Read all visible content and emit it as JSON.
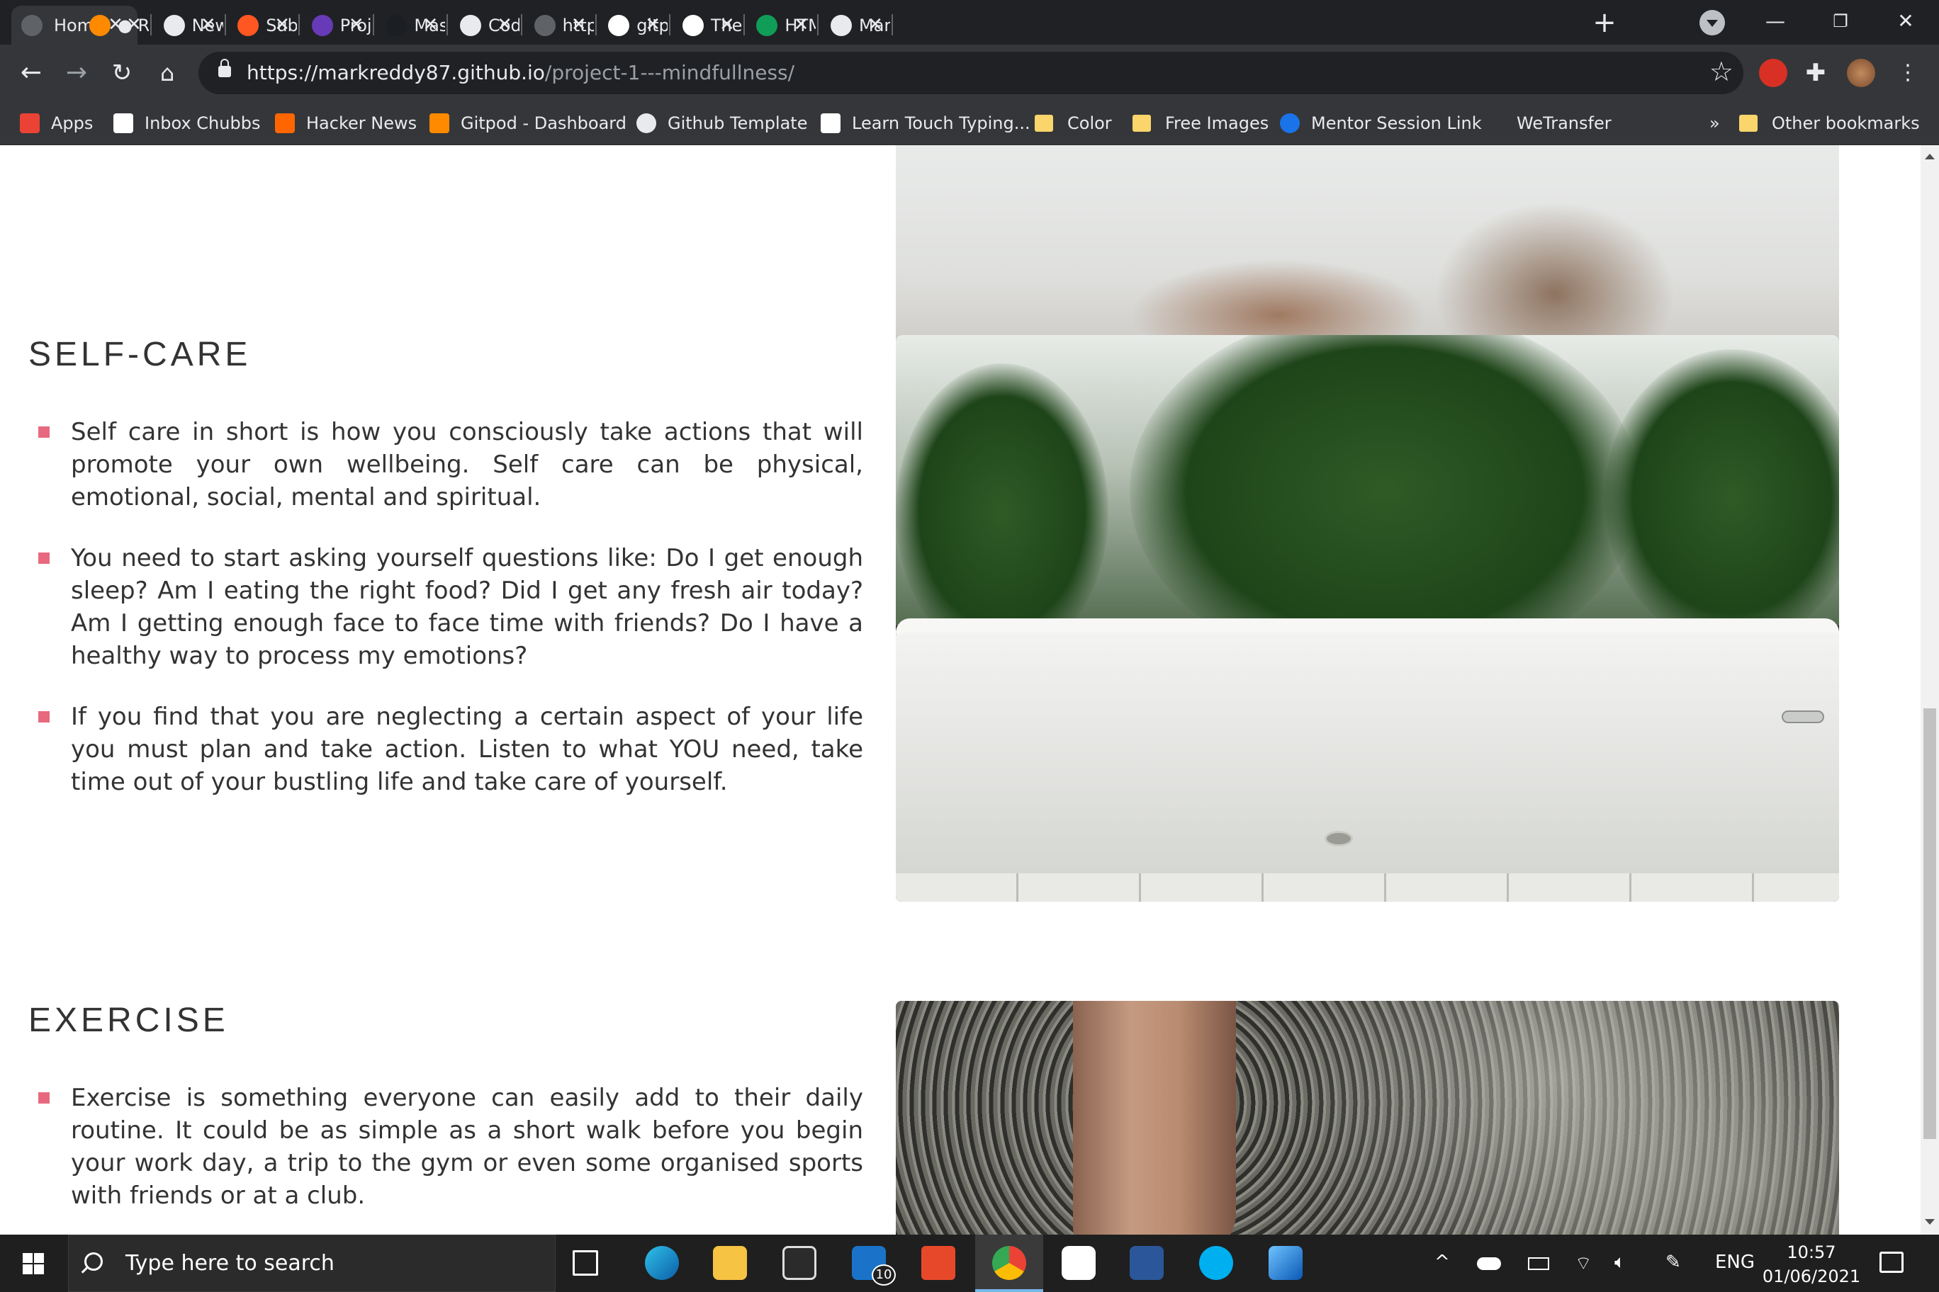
{
  "browser": {
    "tabs": [
      {
        "title": "Hom",
        "active": true,
        "icon": "globe-icon",
        "color": "#5f6368"
      },
      {
        "title": "● RE/",
        "icon": "gitpod-icon",
        "color": "#ff8a00"
      },
      {
        "title": "New",
        "icon": "smiley-icon",
        "color": "#e8eaed"
      },
      {
        "title": "Subn",
        "icon": "codeinstitute-icon",
        "color": "#ff5722"
      },
      {
        "title": "Proje",
        "icon": "list-icon",
        "color": "#673ab7"
      },
      {
        "title": "Mast",
        "icon": "github-icon",
        "color": "#1b1f23"
      },
      {
        "title": "Code",
        "icon": "github-icon",
        "color": "#e8eaed"
      },
      {
        "title": "https",
        "icon": "globe-icon",
        "color": "#5f6368"
      },
      {
        "title": "gitpo",
        "icon": "google-icon",
        "color": "#ffffff"
      },
      {
        "title": "The V",
        "icon": "w3schools-icon",
        "color": "#ffffff"
      },
      {
        "title": "HTM",
        "icon": "w-icon",
        "color": "#0f9d58"
      },
      {
        "title": "Mark",
        "icon": "github-icon",
        "color": "#e8eaed"
      }
    ],
    "tab_close_glyph": "✕",
    "new_tab_glyph": "+",
    "url_host": "https://markreddy87.github.io",
    "url_path": "/project-1---mindfullness/",
    "bookmarks": [
      {
        "label": "Apps",
        "icon": "apps-grid-icon"
      },
      {
        "label": "Inbox Chubbs",
        "icon": "gmail-icon"
      },
      {
        "label": "Hacker News",
        "icon": "y-combinator-icon"
      },
      {
        "label": "Gitpod - Dashboard",
        "icon": "gitpod-icon"
      },
      {
        "label": "Github Template",
        "icon": "github-icon"
      },
      {
        "label": "Learn Touch Typing...",
        "icon": "typing-icon"
      },
      {
        "label": "Color",
        "icon": "folder-icon"
      },
      {
        "label": "Free Images",
        "icon": "folder-icon"
      },
      {
        "label": "Mentor Session Link",
        "icon": "calendly-icon"
      },
      {
        "label": "WeTransfer",
        "icon": "wetransfer-icon"
      }
    ],
    "overflow_glyph": "»",
    "other_bookmarks": "Other bookmarks"
  },
  "page": {
    "sections": [
      {
        "heading": "SELF-CARE",
        "items": [
          "Self care in short is how you consciously take actions that will promote your own wellbeing. Self care can be physical, emotional, social, mental and spiritual.",
          "You need to start asking yourself questions like: Do I get enough sleep? Am I eating the right food? Did I get any fresh air today? Am I getting enough face to face time with friends? Do I have a healthy way to process my emotions?",
          "If you find that you are neglecting a certain aspect of your life you must plan and take action. Listen to what YOU need, take time out of your bustling life and take care of yourself."
        ]
      },
      {
        "heading": "EXERCISE",
        "items": [
          "Exercise is something everyone can easily add to their daily routine. It could be as simple as a short walk before you begin your work day, a trip to the gym or even some organised sports with friends or at a club."
        ]
      }
    ],
    "bullet_color": "#e8697e"
  },
  "taskbar": {
    "search_placeholder": "Type here to search",
    "mail_badge": "10",
    "language": "ENG",
    "time": "10:57",
    "date": "01/06/2021"
  }
}
